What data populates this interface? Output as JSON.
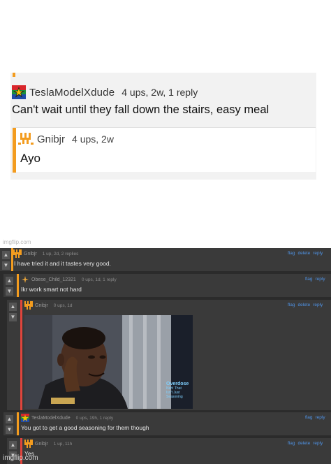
{
  "top_comment": {
    "username": "TeslaModelXdude",
    "meta": "4 ups, 2w, 1 reply",
    "text": "Can't wait until they fall down the stairs, easy meal",
    "reply": {
      "username": "Gnibjr",
      "meta": "4 ups, 2w",
      "text": "Ayo"
    }
  },
  "watermark_top": "imgflip.com",
  "thread": {
    "action_labels": {
      "flag": "flag",
      "delete": "delete",
      "reply": "reply"
    },
    "comments": [
      {
        "username": "Gnibjr",
        "meta": "1 up, 2d, 2 replies",
        "text": "I have tried it and it tastes very good.",
        "actions": [
          "flag",
          "delete",
          "reply"
        ],
        "bar_color": "#f39c1f"
      },
      {
        "username": "Obese_Child_12321",
        "meta": "0 ups, 1d, 1 reply",
        "text": "Ikr work smart not hard",
        "actions": [
          "flag",
          "reply"
        ],
        "bar_color": "#f39c1f"
      },
      {
        "username": "Gnibjr",
        "meta": "0 ups, 1d",
        "text": "",
        "actions": [
          "flag",
          "delete",
          "reply"
        ],
        "bar_color": "#e0443c"
      },
      {
        "username": "TeslaModelXdude",
        "meta": "0 ups, 19h, 1 reply",
        "text": "You got to get a good seasoning for them though",
        "actions": [
          "flag",
          "reply"
        ],
        "bar_color": "#f39c1f"
      },
      {
        "username": "Gnibjr",
        "meta": "1 up, 11h",
        "text": "Yes",
        "actions": [
          "flag",
          "delete",
          "reply"
        ],
        "bar_color": "#e0443c"
      }
    ],
    "meme_caption": {
      "line1": "Overdose",
      "line2": "Nah! That",
      "line3": "Isn't Just",
      "line4": "Seasoning"
    }
  },
  "watermark_bottom": "imgflip.com",
  "colors": {
    "accent_orange": "#f39c1f",
    "accent_red": "#e0443c",
    "link_blue": "#4f93e6"
  }
}
